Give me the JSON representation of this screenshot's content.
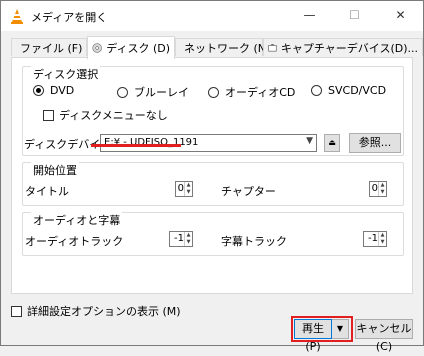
{
  "window": {
    "title": "メディアを開く",
    "controls": {
      "minimize": "—",
      "maximize": "☐",
      "close": "✕"
    }
  },
  "tabs": [
    {
      "label": "ファイル (F)",
      "icon": "file-icon",
      "active": false
    },
    {
      "label": "ディスク (D)",
      "icon": "disc-icon",
      "active": true
    },
    {
      "label": "ネットワーク (N)",
      "icon": "network-icon",
      "active": false
    },
    {
      "label": "キャプチャーデバイス(D)...",
      "icon": "capture-icon",
      "active": false
    }
  ],
  "disc_selection": {
    "title": "ディスク選択",
    "options": [
      {
        "label": "DVD",
        "selected": true
      },
      {
        "label": "ブルーレイ",
        "selected": false
      },
      {
        "label": "オーディオCD",
        "selected": false
      },
      {
        "label": "SVCD/VCD",
        "selected": false
      }
    ],
    "no_menu_label": "ディスクメニューなし",
    "no_menu_checked": false,
    "device_label": "ディスクデバイス",
    "device_value": "E:¥ - UDFISO_1191",
    "browse_label": "参照..."
  },
  "start_position": {
    "title": "開始位置",
    "title_label": "タイトル",
    "title_value": "0",
    "chapter_label": "チャプター",
    "chapter_value": "0"
  },
  "audio_subtitles": {
    "title": "オーディオと字幕",
    "audio_label": "オーディオトラック",
    "audio_value": "-1",
    "subtitle_label": "字幕トラック",
    "subtitle_value": "-1"
  },
  "footer": {
    "show_more_label": "詳細設定オプションの表示 (M)",
    "show_more_checked": false,
    "play_label": "再生 (P)",
    "cancel_label": "キャンセル (C)"
  },
  "colors": {
    "highlight": "#e02020",
    "accent": "#0078d7"
  }
}
